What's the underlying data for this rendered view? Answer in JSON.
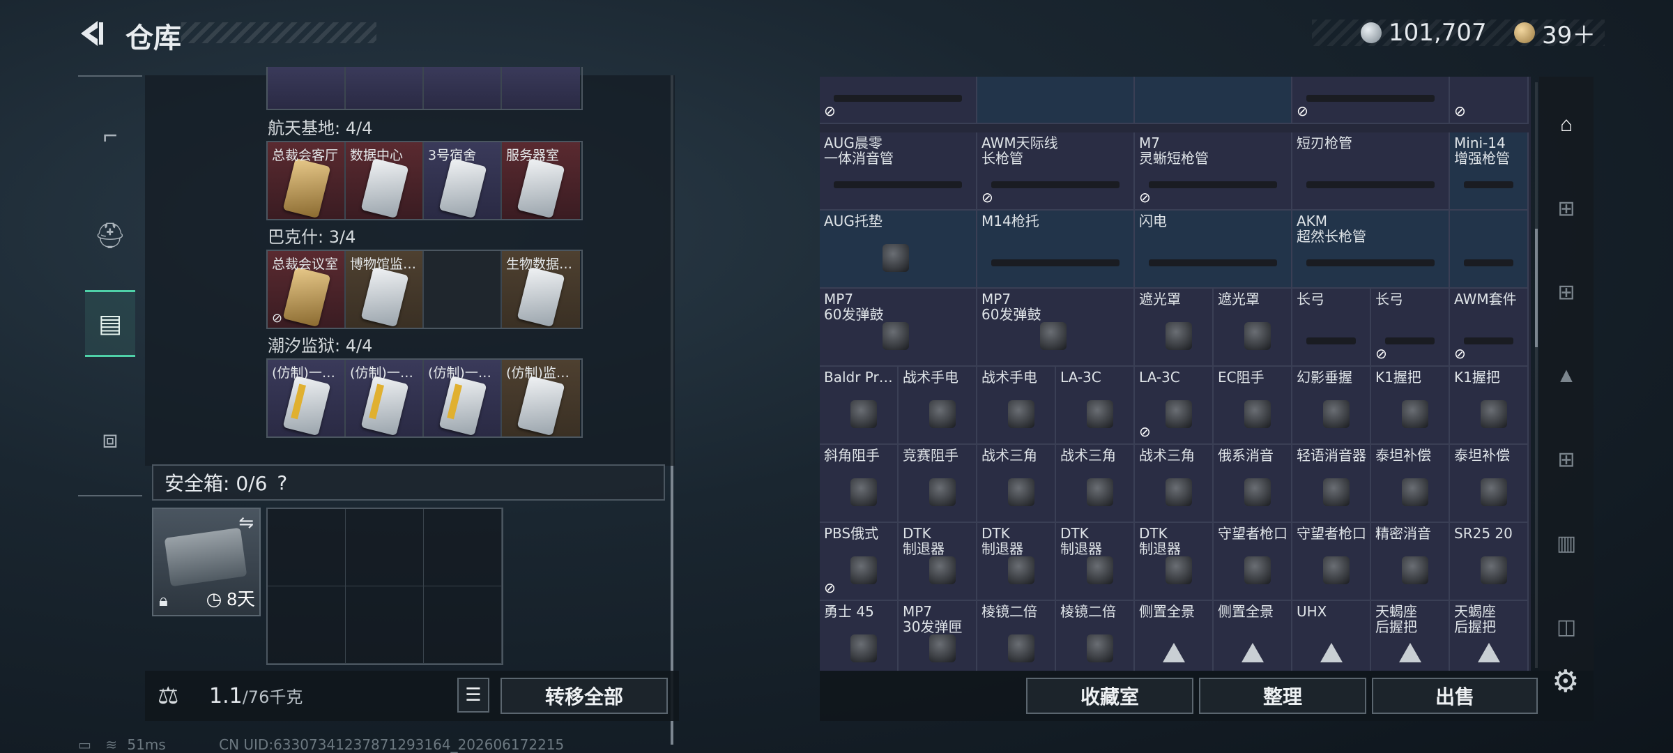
{
  "header": {
    "title": "仓库"
  },
  "currency": {
    "silver": "101,707",
    "gold": "39＋"
  },
  "rail": [
    {
      "icon": "pistol-icon"
    },
    {
      "icon": "backpack-icon"
    },
    {
      "icon": "keycard-holder-icon",
      "active": true
    },
    {
      "icon": "toolbox-icon"
    }
  ],
  "groups": [
    {
      "title": "航天基地: 4/4",
      "slots": [
        {
          "label": "总裁会客厅",
          "style": "red",
          "card": "gold"
        },
        {
          "label": "数据中心",
          "style": "red",
          "card": "white"
        },
        {
          "label": "3号宿舍",
          "style": "purple",
          "card": "white"
        },
        {
          "label": "服务器室",
          "style": "red",
          "card": "white"
        }
      ]
    },
    {
      "title": "巴克什: 3/4",
      "slots": [
        {
          "label": "总裁会议室",
          "style": "red",
          "card": "gold",
          "no_trade": true
        },
        {
          "label": "博物馆监…",
          "style": "gold",
          "card": "white"
        },
        {
          "label": "",
          "style": "empty",
          "card": ""
        },
        {
          "label": "生物数据…",
          "style": "gold",
          "card": "white"
        }
      ]
    },
    {
      "title": "潮汐监狱: 4/4",
      "slots": [
        {
          "label": "(仿制)一…",
          "style": "purple",
          "card": "stripe"
        },
        {
          "label": "(仿制)一…",
          "style": "purple",
          "card": "stripe"
        },
        {
          "label": "(仿制)一…",
          "style": "purple",
          "card": "stripe"
        },
        {
          "label": "(仿制)监…",
          "style": "gold",
          "card": "white"
        }
      ]
    }
  ],
  "safebox": {
    "label": "安全箱: 0/6",
    "help": "?",
    "days": "8天"
  },
  "weight": {
    "current": "1.1",
    "max": "/76千克"
  },
  "buttons": {
    "transfer_all": "转移全部",
    "collection": "收藏室",
    "sort": "整理",
    "sell": "出售"
  },
  "status": {
    "ping": "51ms",
    "uid": "CN UID:6330734123787129316​4_202606172215"
  },
  "inventory_rows": [
    [
      {
        "name": "",
        "w": 2,
        "kind": "gun",
        "no_trade": true
      },
      {
        "name": "",
        "w": 2,
        "kind": "none",
        "blue": true
      },
      {
        "name": "",
        "w": 2,
        "kind": "none",
        "blue": true
      },
      {
        "name": "",
        "w": 2,
        "kind": "gun",
        "no_trade": true
      },
      {
        "name": "",
        "w": 1,
        "kind": "none",
        "no_trade": true
      }
    ],
    [
      {
        "name": "AUG晨零\n一体消音管",
        "w": 2,
        "kind": "gun"
      },
      {
        "name": "AWM天际线\n长枪管",
        "w": 2,
        "kind": "gun",
        "no_trade": true
      },
      {
        "name": "M7\n灵蜥短枪管",
        "w": 2,
        "kind": "gun",
        "no_trade": true
      },
      {
        "name": "短刃枪管",
        "w": 2,
        "kind": "gun"
      },
      {
        "name": "Mini-14\n增强枪管",
        "w": 1,
        "kind": "gun",
        "blue": true
      }
    ],
    [
      {
        "name": "AUG托垫",
        "w": 2,
        "kind": "part",
        "blue": true
      },
      {
        "name": "M14枪托",
        "w": 2,
        "kind": "gun",
        "blue": true
      },
      {
        "name": "闪电",
        "w": 2,
        "kind": "gun",
        "blue": true
      },
      {
        "name": "AKM\n超然长枪管",
        "w": 2,
        "kind": "gun",
        "blue": true
      },
      {
        "name": "",
        "w": 1,
        "kind": "gun",
        "blue": true
      }
    ],
    [
      {
        "name": "MP7\n60发弹鼓",
        "w": 2,
        "kind": "part"
      },
      {
        "name": "MP7\n60发弹鼓",
        "w": 2,
        "kind": "part"
      },
      {
        "name": "遮光罩",
        "w": 1,
        "kind": "part"
      },
      {
        "name": "遮光罩",
        "w": 1,
        "kind": "part"
      },
      {
        "name": "长弓",
        "w": 1,
        "kind": "gun"
      },
      {
        "name": "长弓",
        "w": 1,
        "kind": "gun",
        "no_trade": true
      },
      {
        "name": "AWM套件",
        "w": 1,
        "kind": "gun",
        "no_trade": true
      }
    ],
    [
      {
        "name": "Baldr Pr…",
        "w": 1,
        "kind": "part"
      },
      {
        "name": "战术手电",
        "w": 1,
        "kind": "part"
      },
      {
        "name": "战术手电",
        "w": 1,
        "kind": "part"
      },
      {
        "name": "LA-3C",
        "w": 1,
        "kind": "part"
      },
      {
        "name": "LA-3C",
        "w": 1,
        "kind": "part",
        "no_trade": true
      },
      {
        "name": "EC阻手",
        "w": 1,
        "kind": "part"
      },
      {
        "name": "幻影垂握",
        "w": 1,
        "kind": "part"
      },
      {
        "name": "K1握把",
        "w": 1,
        "kind": "part"
      },
      {
        "name": "K1握把",
        "w": 1,
        "kind": "part"
      }
    ],
    [
      {
        "name": "斜角阻手",
        "w": 1,
        "kind": "part"
      },
      {
        "name": "竞赛阻手",
        "w": 1,
        "kind": "part"
      },
      {
        "name": "战术三角",
        "w": 1,
        "kind": "part"
      },
      {
        "name": "战术三角",
        "w": 1,
        "kind": "part"
      },
      {
        "name": "战术三角",
        "w": 1,
        "kind": "part"
      },
      {
        "name": "俄系消音",
        "w": 1,
        "kind": "part"
      },
      {
        "name": "轻语消音器",
        "w": 1,
        "kind": "part"
      },
      {
        "name": "泰坦补偿",
        "w": 1,
        "kind": "part"
      },
      {
        "name": "泰坦补偿",
        "w": 1,
        "kind": "part"
      }
    ],
    [
      {
        "name": "PBS俄式",
        "w": 1,
        "kind": "part",
        "no_trade": true
      },
      {
        "name": "DTK\n制退器",
        "w": 1,
        "kind": "part"
      },
      {
        "name": "DTK\n制退器",
        "w": 1,
        "kind": "part"
      },
      {
        "name": "DTK\n制退器",
        "w": 1,
        "kind": "part"
      },
      {
        "name": "DTK\n制退器",
        "w": 1,
        "kind": "part"
      },
      {
        "name": "守望者枪口",
        "w": 1,
        "kind": "part"
      },
      {
        "name": "守望者枪口",
        "w": 1,
        "kind": "part"
      },
      {
        "name": "精密消音",
        "w": 1,
        "kind": "part"
      },
      {
        "name": "SR25 20",
        "w": 1,
        "kind": "part"
      }
    ],
    [
      {
        "name": "勇士 45",
        "w": 1,
        "kind": "part"
      },
      {
        "name": "MP7\n30发弹匣",
        "w": 1,
        "kind": "part"
      },
      {
        "name": "棱镜二倍",
        "w": 1,
        "kind": "part"
      },
      {
        "name": "棱镜二倍",
        "w": 1,
        "kind": "part"
      },
      {
        "name": "侧置全景",
        "w": 1,
        "kind": "tri"
      },
      {
        "name": "侧置全景",
        "w": 1,
        "kind": "tri"
      },
      {
        "name": "UHX",
        "w": 1,
        "kind": "tri"
      },
      {
        "name": "天蝎座\n后握把",
        "w": 1,
        "kind": "tri"
      },
      {
        "name": "天蝎座\n后握把",
        "w": 1,
        "kind": "tri"
      }
    ]
  ],
  "right_rail": [
    {
      "icon": "home-stash-icon",
      "active": true
    },
    {
      "icon": "add-stash-icon"
    },
    {
      "icon": "add-stash-icon"
    },
    {
      "icon": "stash-tier-3-icon"
    },
    {
      "icon": "add-stash-icon"
    },
    {
      "icon": "stash-folder-icon"
    },
    {
      "icon": "stash-tier-4-icon"
    }
  ]
}
